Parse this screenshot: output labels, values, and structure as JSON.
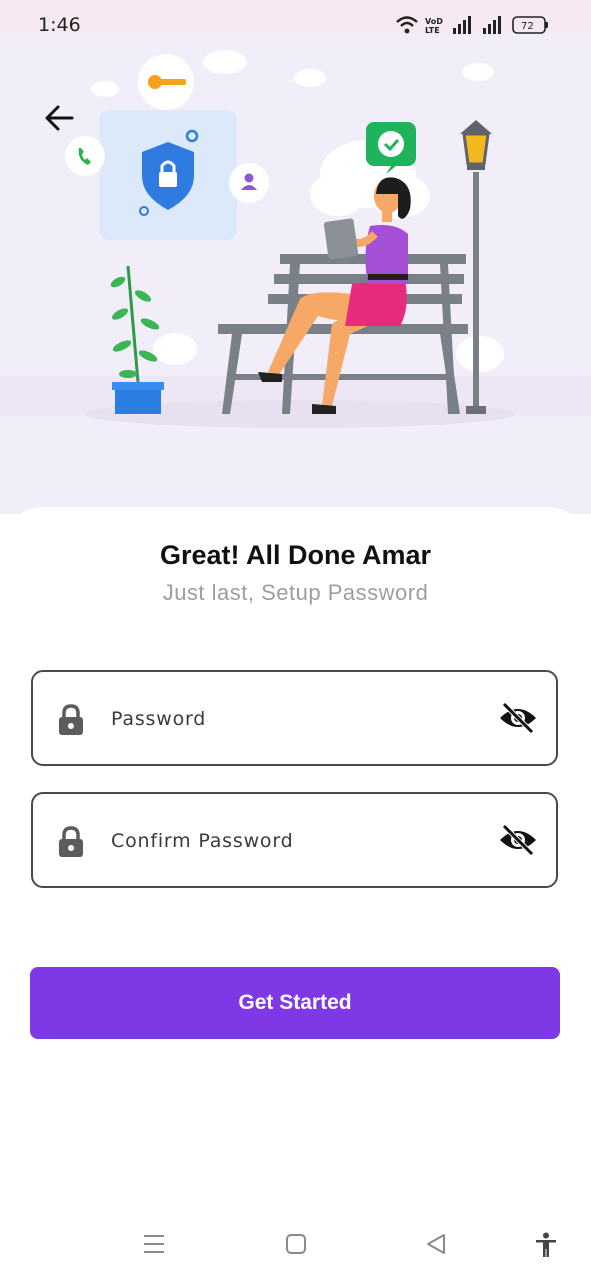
{
  "status_bar": {
    "time": "1:46",
    "battery": "72",
    "icons": [
      "wifi-icon",
      "volte-icon",
      "signal-icon",
      "signal-icon",
      "battery-icon"
    ]
  },
  "header": {
    "back_icon": "arrow-left-icon"
  },
  "hero": {
    "illustration": "woman-on-bench-security-illustration"
  },
  "main": {
    "title": "Great! All Done Amar",
    "subtitle": "Just last, Setup Password",
    "password": {
      "placeholder": "Password",
      "value": "",
      "icon": "lock-icon",
      "toggle_icon": "eye-off-icon"
    },
    "confirm_password": {
      "placeholder": "Confirm Password",
      "value": "",
      "icon": "lock-icon",
      "toggle_icon": "eye-off-icon"
    },
    "cta_label": "Get Started"
  },
  "nav_bar": {
    "items": [
      "menu-icon",
      "home-icon",
      "back-icon",
      "accessibility-icon"
    ]
  },
  "colors": {
    "primary": "#7e38e6",
    "hero_bg": "#f2eef9",
    "status_bg": "#f7e9f1",
    "subtitle": "#9e9e9e"
  }
}
